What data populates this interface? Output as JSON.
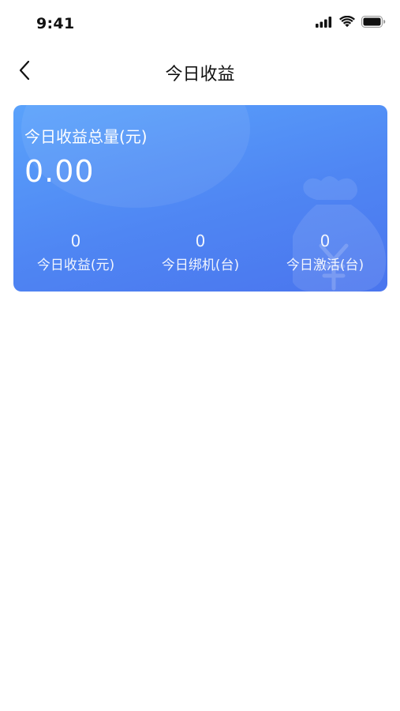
{
  "status_bar": {
    "time": "9:41",
    "icons": [
      "signal-icon",
      "wifi-icon",
      "battery-icon"
    ]
  },
  "nav": {
    "back_icon": "chevron-left-icon",
    "title": "今日收益"
  },
  "card": {
    "title": "今日收益总量(元)",
    "total": "0.00",
    "stats": [
      {
        "value": "0",
        "label": "今日收益(元)"
      },
      {
        "value": "0",
        "label": "今日绑机(台)"
      },
      {
        "value": "0",
        "label": "今日激活(台)"
      }
    ],
    "deco_icon": "money-bag-icon",
    "colors": {
      "gradient_start": "#5aa2fb",
      "gradient_end": "#4a75ee"
    }
  }
}
